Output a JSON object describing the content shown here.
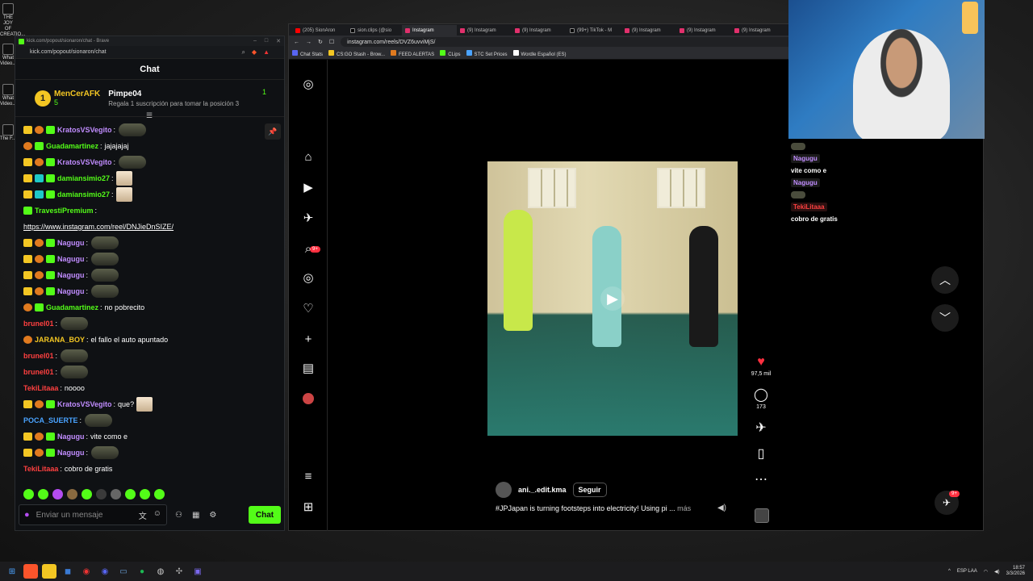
{
  "desktop": {
    "icons": [
      "THE JOY OF CREATIO...",
      "What Video...",
      "What Video...",
      "The F..."
    ]
  },
  "chat_window": {
    "title": "kick.com/popout/sionaron/chat - Brave",
    "url": "kick.com/popout/sionaron/chat",
    "header": "Chat",
    "pinned": {
      "rank": "1",
      "top_user": "MenCerAFK",
      "top_count": "5",
      "second_user": "Pimpe04",
      "second_count": "1",
      "second_sub": "Regala 1 suscripción para tomar la posición 3"
    },
    "messages": [
      {
        "user": "KratosVSVegito",
        "color": "#c18dff",
        "text": "",
        "emote": true
      },
      {
        "user": "Guadamartinez",
        "color": "#53fc18",
        "text": "jajajajaj",
        "emote": false
      },
      {
        "user": "KratosVSVegito",
        "color": "#c18dff",
        "text": "",
        "emote": true
      },
      {
        "user": "damiansimio27",
        "color": "#53fc18",
        "text": "",
        "img": true
      },
      {
        "user": "damiansimio27",
        "color": "#53fc18",
        "text": "",
        "img": true
      },
      {
        "user": "TravestiPremium",
        "color": "#53fc18",
        "text": "",
        "emote": false
      },
      {
        "user": "",
        "color": "#fff",
        "text": "https://www.instagram.com/reel/DNJieDnSIZE/",
        "link": true
      },
      {
        "user": "Nagugu",
        "color": "#c18dff",
        "text": "",
        "emote": true
      },
      {
        "user": "Nagugu",
        "color": "#c18dff",
        "text": "",
        "emote": true
      },
      {
        "user": "Nagugu",
        "color": "#c18dff",
        "text": "",
        "emote": true
      },
      {
        "user": "Nagugu",
        "color": "#c18dff",
        "text": "",
        "emote": true
      },
      {
        "user": "Guadamartinez",
        "color": "#53fc18",
        "text": "no pobrecito",
        "emote": false
      },
      {
        "user": "brunel01",
        "color": "#ff4040",
        "text": "",
        "emote": true
      },
      {
        "user": "JARANA_BOY",
        "color": "#f3c623",
        "text": "el fallo el auto apuntado",
        "emote": false
      },
      {
        "user": "brunel01",
        "color": "#ff4040",
        "text": "",
        "emote": true
      },
      {
        "user": "brunel01",
        "color": "#ff4040",
        "text": "",
        "emote": true
      },
      {
        "user": "TekiLitaaa",
        "color": "#ff4040",
        "text": "noooo",
        "emote": false
      },
      {
        "user": "KratosVSVegito",
        "color": "#c18dff",
        "text": "que?",
        "img": true
      },
      {
        "user": "POCA_SUERTE",
        "color": "#4aa3ff",
        "text": "",
        "emote": true
      },
      {
        "user": "Nagugu",
        "color": "#c18dff",
        "text": "vite como e",
        "emote": false
      },
      {
        "user": "Nagugu",
        "color": "#c18dff",
        "text": "",
        "emote": true
      },
      {
        "user": "TekiLitaaa",
        "color": "#ff4040",
        "text": "cobro de gratis",
        "emote": false
      }
    ],
    "input_placeholder": "Enviar un mensaje",
    "send_label": "Chat"
  },
  "browser": {
    "tabs": [
      {
        "label": "(205) SionAron",
        "type": "yt",
        "active": false
      },
      {
        "label": "sion.clips (@sio",
        "type": "tk",
        "active": false
      },
      {
        "label": "Instagram",
        "type": "ig",
        "active": true
      },
      {
        "label": "(9) Instagram",
        "type": "ig",
        "active": false
      },
      {
        "label": "(9) Instagram",
        "type": "ig",
        "active": false
      },
      {
        "label": "(99+) TikTok - M",
        "type": "tk",
        "active": false
      },
      {
        "label": "(9) Instagram",
        "type": "ig",
        "active": false
      },
      {
        "label": "(9) Instagram",
        "type": "ig",
        "active": false
      },
      {
        "label": "(9) Instagram",
        "type": "ig",
        "active": false
      }
    ],
    "url": "instagram.com/reels/DVZ6uvviMjS/",
    "bookmarks": [
      "Chat Stats",
      "CS:GO Stash - Brow...",
      "FEED ALERTAS",
      "CLips",
      "STC Set Prices",
      "Wordle Español (ES)"
    ],
    "sidebar_badge": "9+",
    "reel": {
      "username": "ani._.edit.kma",
      "follow_label": "Seguir",
      "caption": "#JPJapan is turning footsteps into electricity! Using pi ...",
      "more_label": "más",
      "likes": "97,5 mil",
      "comments": "173"
    },
    "dm_badge": "9+"
  },
  "overlay_chat": [
    {
      "user": "Nagugu",
      "text": "vite como e",
      "red": false
    },
    {
      "user": "Nagugu",
      "text": "",
      "red": false
    },
    {
      "user": "TekiLitaaa",
      "text": "cobro de gratis",
      "red": true
    }
  ],
  "taskbar": {
    "lang": "ESP LAA",
    "time": "18:57",
    "date": "3/3/2026"
  },
  "colors": {
    "kick_green": "#53fc18",
    "ig_red": "#ff3040",
    "gold": "#f3c623"
  }
}
